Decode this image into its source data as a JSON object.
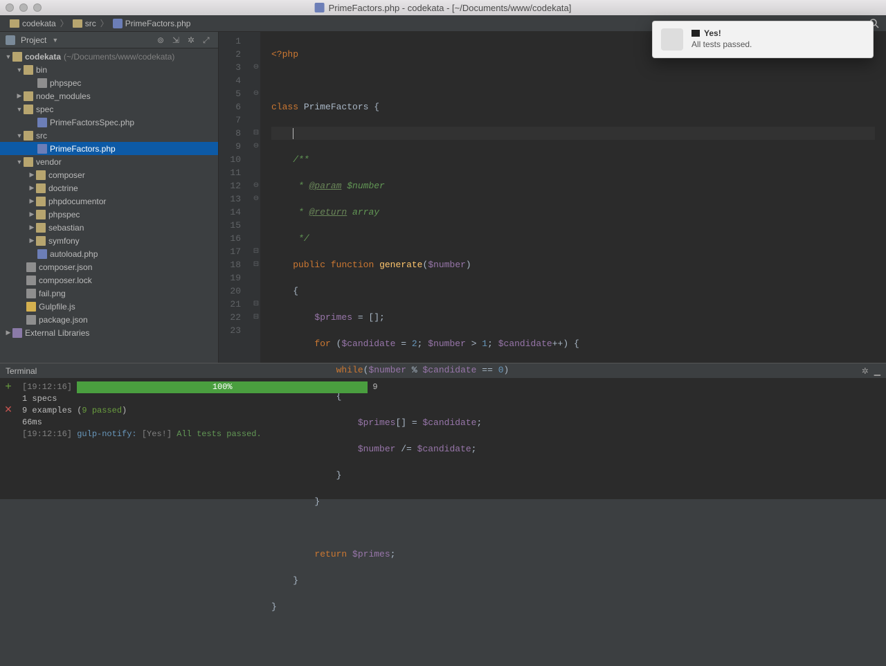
{
  "window": {
    "title": "PrimeFactors.php - codekata - [~/Documents/www/codekata]"
  },
  "breadcrumb": {
    "root": "codekata",
    "folder": "src",
    "file": "PrimeFactors.php"
  },
  "sidebar": {
    "header": "Project",
    "tree": {
      "project": {
        "name": "codekata",
        "path": "(~/Documents/www/codekata)"
      },
      "bin": "bin",
      "bin_items": {
        "phpspec": "phpspec"
      },
      "node_modules": "node_modules",
      "spec": "spec",
      "spec_items": {
        "primeFactorsSpec": "PrimeFactorsSpec.php"
      },
      "src": "src",
      "src_items": {
        "primeFactors": "PrimeFactors.php"
      },
      "vendor": "vendor",
      "vendor_items": {
        "composer": "composer",
        "doctrine": "doctrine",
        "phpdocumentor": "phpdocumentor",
        "phpspec": "phpspec",
        "sebastian": "sebastian",
        "symfony": "symfony",
        "autoload": "autoload.php"
      },
      "root_files": {
        "composer_json": "composer.json",
        "composer_lock": "composer.lock",
        "fail_png": "fail.png",
        "gulpfile": "Gulpfile.js",
        "package_json": "package.json"
      },
      "external": "External Libraries"
    }
  },
  "editor": {
    "lines": [
      "1",
      "2",
      "3",
      "4",
      "5",
      "6",
      "7",
      "8",
      "9",
      "10",
      "11",
      "12",
      "13",
      "14",
      "15",
      "16",
      "17",
      "18",
      "19",
      "20",
      "21",
      "22",
      "23"
    ],
    "code": {
      "l1_open": "<?php",
      "l3_class": "class",
      "l3_name": "PrimeFactors {",
      "l5": "/**",
      "l6_pre": " * ",
      "l6_tag": "@param",
      "l6_rest": " $number",
      "l7_pre": " * ",
      "l7_tag": "@return",
      "l7_rest": " array",
      "l8": " */",
      "l9_public": "public",
      "l9_function": "function",
      "l9_name": "generate",
      "l9_paren": "(",
      "l9_var": "$number",
      "l9_close": ")",
      "l10": "{",
      "l11_var": "$primes",
      "l11_rest": " = [];",
      "l12_for": "for",
      "l12_p1": " (",
      "l12_cand": "$candidate",
      "l12_eq": " = ",
      "l12_two": "2",
      "l12_sc1": "; ",
      "l12_num": "$number",
      "l12_gt": " > ",
      "l12_one": "1",
      "l12_sc2": "; ",
      "l12_cand2": "$candidate",
      "l12_inc": "++) {",
      "l13_while": "while",
      "l13_p": "(",
      "l13_num": "$number",
      "l13_mod": " % ",
      "l13_cand": "$candidate",
      "l13_eqeq": " == ",
      "l13_zero": "0",
      "l13_close": ")",
      "l14": "{",
      "l15_primes": "$primes",
      "l15_br": "[] = ",
      "l15_cand": "$candidate",
      "l15_sc": ";",
      "l16_num": "$number",
      "l16_op": " /= ",
      "l16_cand": "$candidate",
      "l16_sc": ";",
      "l17": "}",
      "l18": "}",
      "l20_return": "return",
      "l20_sp": " ",
      "l20_var": "$primes",
      "l20_sc": ";",
      "l21": "}",
      "l22": "}"
    }
  },
  "notification": {
    "title": "Yes!",
    "message": "All tests passed."
  },
  "terminal": {
    "tab": "Terminal",
    "ts": "[19:12:16]",
    "percent": "100%",
    "count": "9",
    "specs": "1 specs",
    "examples_pre": "9 examples (",
    "examples_passed": "9 passed",
    "examples_post": ")",
    "duration": "66ms",
    "notify": "gulp-notify:",
    "notify_title": "[Yes!]",
    "notify_msg": "All tests passed."
  }
}
